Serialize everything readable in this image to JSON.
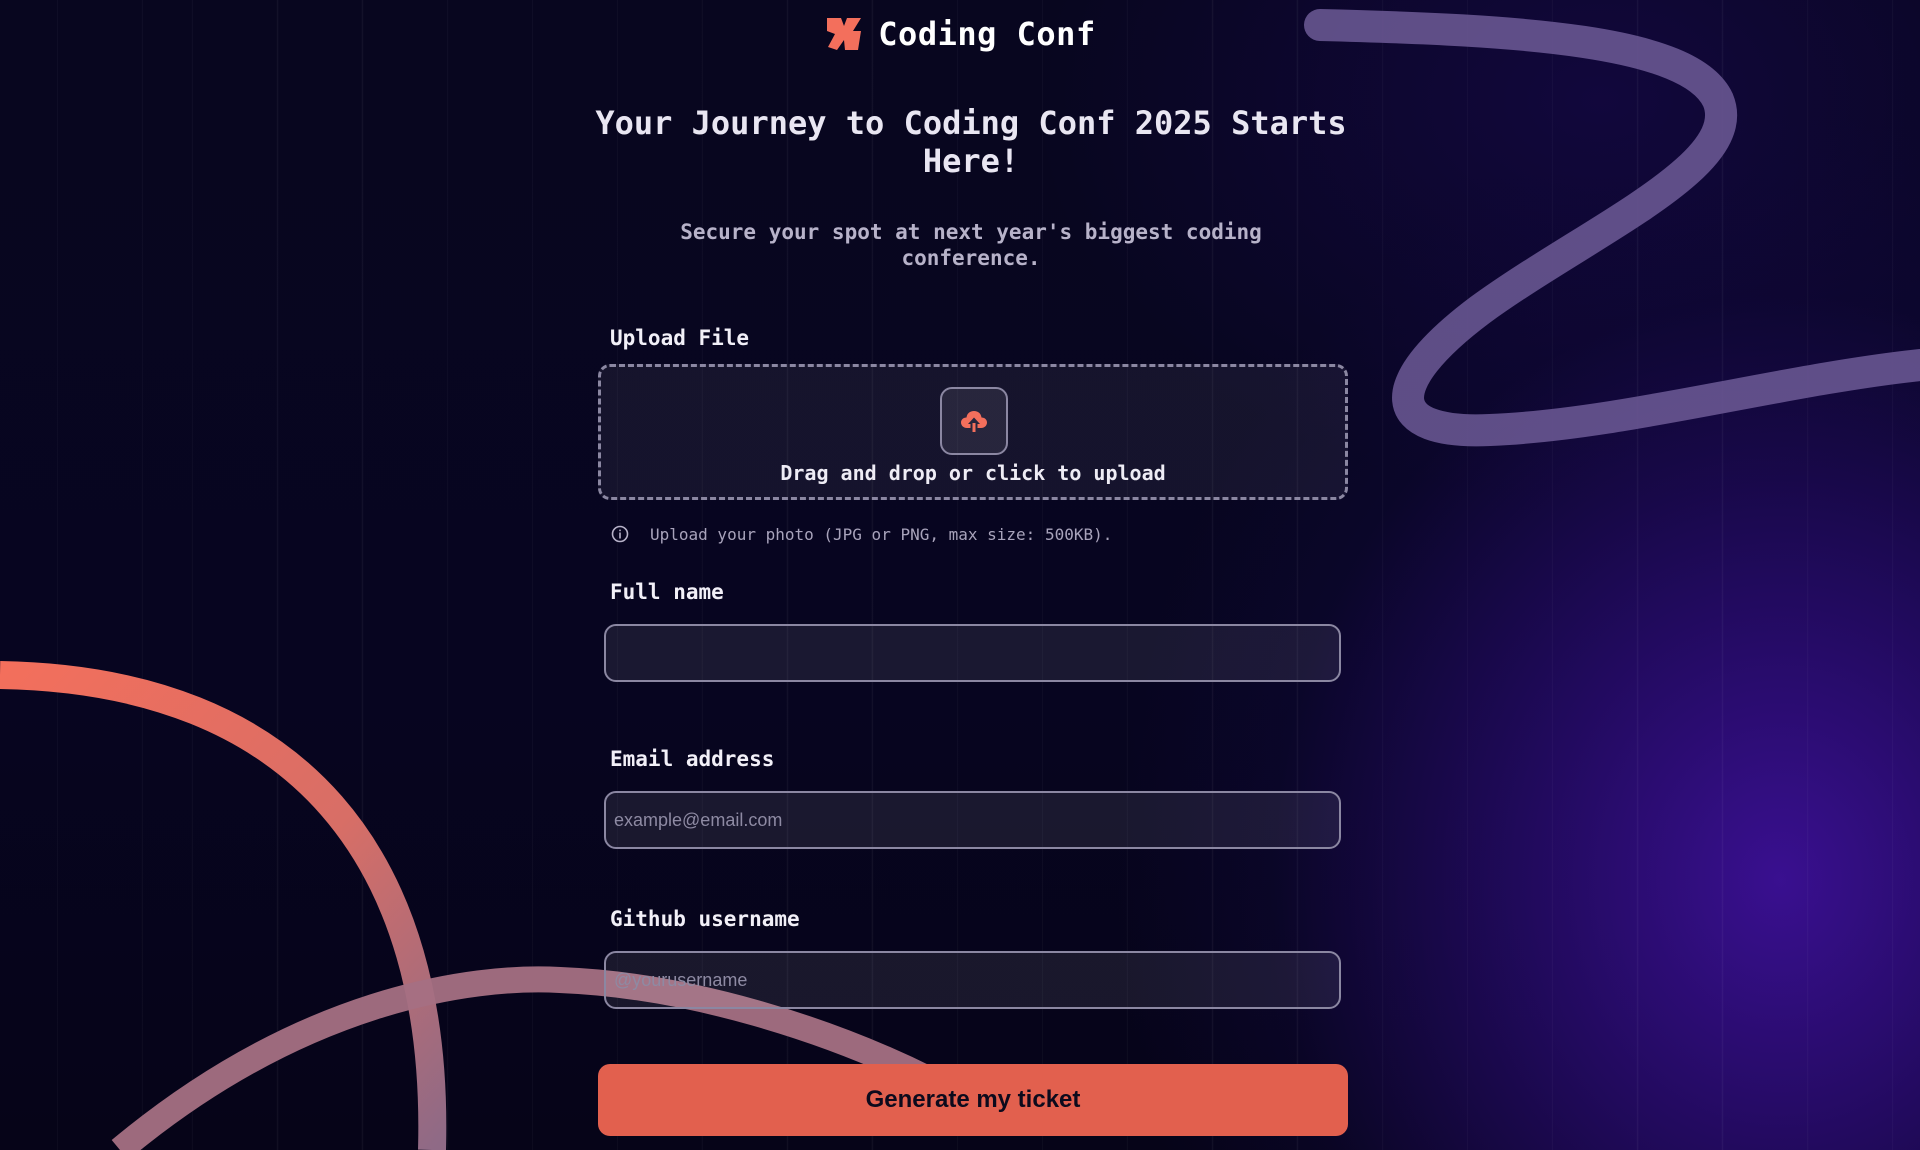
{
  "brand": {
    "name": "Coding Conf",
    "logo_icon": "coding-conf-logo-icon"
  },
  "hero": {
    "title": "Your Journey to Coding Conf 2025 Starts Here!",
    "subtitle": "Secure your spot at next year's biggest coding conference."
  },
  "upload": {
    "label": "Upload File",
    "drop_text": "Drag and drop or click to upload",
    "icon": "cloud-upload-icon",
    "hint": "Upload your photo (JPG or PNG, max size: 500KB).",
    "hint_icon": "info-icon"
  },
  "form": {
    "full_name": {
      "label": "Full name",
      "value": "",
      "placeholder": ""
    },
    "email": {
      "label": "Email address",
      "value": "",
      "placeholder": "example@email.com"
    },
    "github": {
      "label": "Github username",
      "value": "",
      "placeholder": "@yourusername"
    },
    "submit_label": "Generate my ticket"
  },
  "colors": {
    "accent": "#e2604e",
    "background": "#070520",
    "glow": "#3c1096",
    "border": "#8b87a2"
  }
}
